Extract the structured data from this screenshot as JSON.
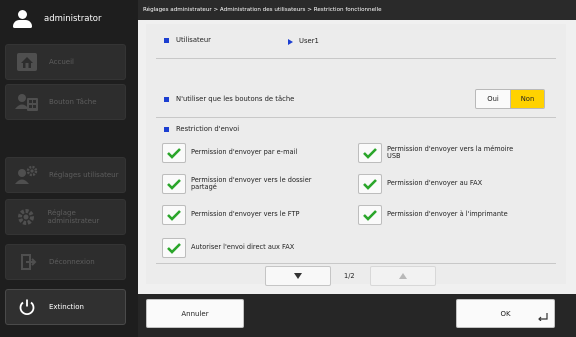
{
  "user": {
    "name": "administrator"
  },
  "sidebar": {
    "items": [
      {
        "label": "Accueil",
        "icon": "home-icon",
        "enabled": false
      },
      {
        "label": "Bouton Tâche",
        "icon": "task-button-icon",
        "enabled": false
      },
      {
        "label": "Réglages utilisateur",
        "icon": "user-settings-icon",
        "enabled": false
      },
      {
        "label": "Réglage administrateur",
        "icon": "admin-settings-icon",
        "enabled": false
      },
      {
        "label": "Déconnexion",
        "icon": "logout-icon",
        "enabled": false
      },
      {
        "label": "Extinction",
        "icon": "power-icon",
        "enabled": true
      }
    ]
  },
  "breadcrumb": "Réglages administrateur > Administration des utilisateurs > Restriction fonctionnelle",
  "utilisateur": {
    "label": "Utilisateur",
    "value": "User1"
  },
  "task_buttons_only": {
    "label": "N'utiliser que les boutons de tâche",
    "oui": "Oui",
    "non": "Non",
    "selected": "Non"
  },
  "restriction": {
    "title": "Restriction d'envoi",
    "permissions": [
      {
        "label": "Permission d'envoyer par e-mail",
        "checked": true
      },
      {
        "label": "Permission d'envoyer vers la mémoire USB",
        "checked": true
      },
      {
        "label": "Permission d'envoyer vers le dossier partagé",
        "checked": true
      },
      {
        "label": "Permission d'envoyer au FAX",
        "checked": true
      },
      {
        "label": "Permission d'envoyer vers le FTP",
        "checked": true
      },
      {
        "label": "Permission d'envoyer à l'imprimante",
        "checked": true
      },
      {
        "label": "Autoriser l'envoi direct aux FAX",
        "checked": true
      }
    ]
  },
  "pager": {
    "page": "1/2",
    "down_icon": "triangle-down-icon",
    "up_icon": "triangle-up-icon"
  },
  "actions": {
    "cancel": "Annuler",
    "ok": "OK"
  },
  "colors": {
    "accent_yellow": "#ffd200",
    "marker_blue": "#1c3fd1",
    "check_green": "#2aa52a"
  }
}
